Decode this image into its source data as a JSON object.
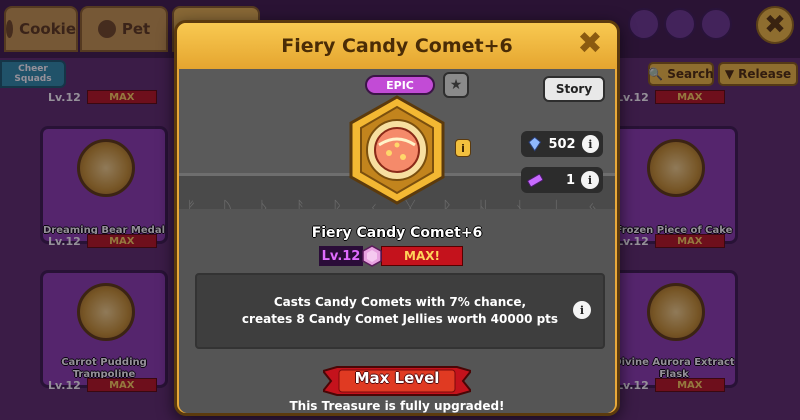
{
  "background": {
    "tabs": [
      {
        "label": "Cookie"
      },
      {
        "label": "Pet"
      }
    ],
    "cheer_squads_label": "Cheer Squads",
    "search_label": "Search",
    "release_label": "Release",
    "cards": [
      {
        "name": "Dreaming Bear Medal",
        "level": "Lv.12",
        "max": "MAX"
      },
      {
        "name": "Carrot Pudding Trampoline",
        "level": "Lv.12",
        "max": "MAX"
      },
      {
        "name": "Frozen Piece of Cake",
        "level": "Lv.12",
        "max": "MAX"
      },
      {
        "name": "Divine Aurora Extract Flask",
        "level": "Lv.12",
        "max": "MAX"
      }
    ],
    "top_row_levels": [
      {
        "level": "Lv.12",
        "max": "MAX"
      },
      {
        "level": "Lv.12",
        "max": "MAX"
      }
    ]
  },
  "modal": {
    "title": "Fiery Candy Comet+6",
    "rarity": "EPIC",
    "story_label": "Story",
    "crystal_count": "502",
    "ticket_count": "1",
    "treasure_name": "Fiery Candy Comet+6",
    "level_label": "Lv.12",
    "max_label": "MAX!",
    "description_line1": "Casts Candy Comets with 7% chance,",
    "description_line2": "creates 8 Candy Comet Jellies worth 40000 pts",
    "max_level_label": "Max Level",
    "upgraded_text": "This Treasure is fully upgraded!",
    "info_glyph": "i",
    "close_glyph": "✖",
    "runes": "ᚠ ᚢ ᚦ ᚨ ᚱ ᚲ ᚷ ᚹ ᚺ ᚾ ᛁ ᛃ ᛇ ᛈ ᛉ ᛊ"
  },
  "colors": {
    "modal_frame": "#e9a93a",
    "epic": "#c24bd6",
    "max_red": "#c4121c"
  }
}
